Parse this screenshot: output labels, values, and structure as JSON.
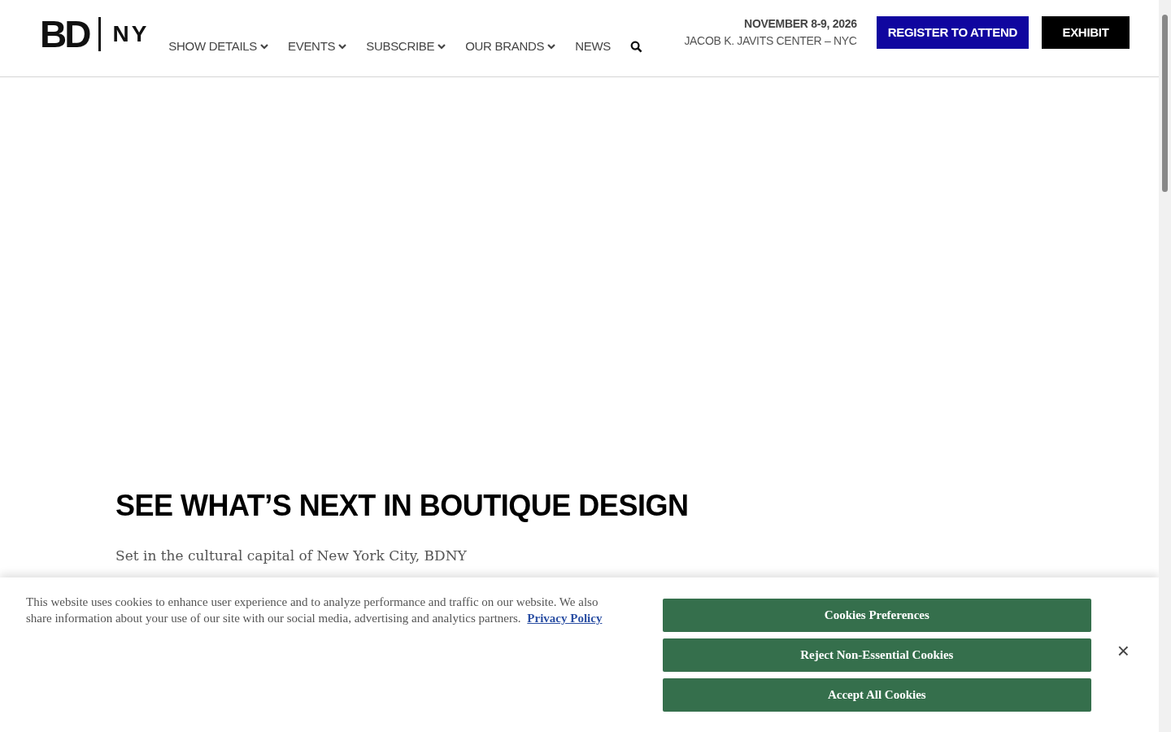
{
  "header": {
    "logo": {
      "left": "BD",
      "right": "NY"
    },
    "nav": [
      {
        "label": "SHOW DETAILS",
        "has_dropdown": true
      },
      {
        "label": "EVENTS",
        "has_dropdown": true
      },
      {
        "label": "SUBSCRIBE",
        "has_dropdown": true
      },
      {
        "label": "OUR BRANDS",
        "has_dropdown": true
      },
      {
        "label": "NEWS",
        "has_dropdown": false
      }
    ],
    "event_date": "NOVEMBER 8-9, 2026",
    "event_venue": "JACOB K. JAVITS CENTER – NYC",
    "buttons": [
      {
        "label": "REGISTER TO ATTEND",
        "kind": "primary"
      },
      {
        "label": "EXHIBIT",
        "kind": "dark"
      }
    ]
  },
  "main": {
    "heading": "SEE WHAT’S NEXT IN BOUTIQUE DESIGN",
    "intro": "Set in the cultural capital of New York City, BDNY"
  },
  "cookie_banner": {
    "text": "This website uses cookies to enhance user experience and to analyze performance and traffic on our website. We also share information about your use of our site with our social media, advertising and analytics partners.",
    "link": "Privacy Policy",
    "buttons": [
      "Cookies Preferences",
      "Reject Non-Essential Cookies",
      "Accept All Cookies"
    ],
    "close": "×"
  }
}
